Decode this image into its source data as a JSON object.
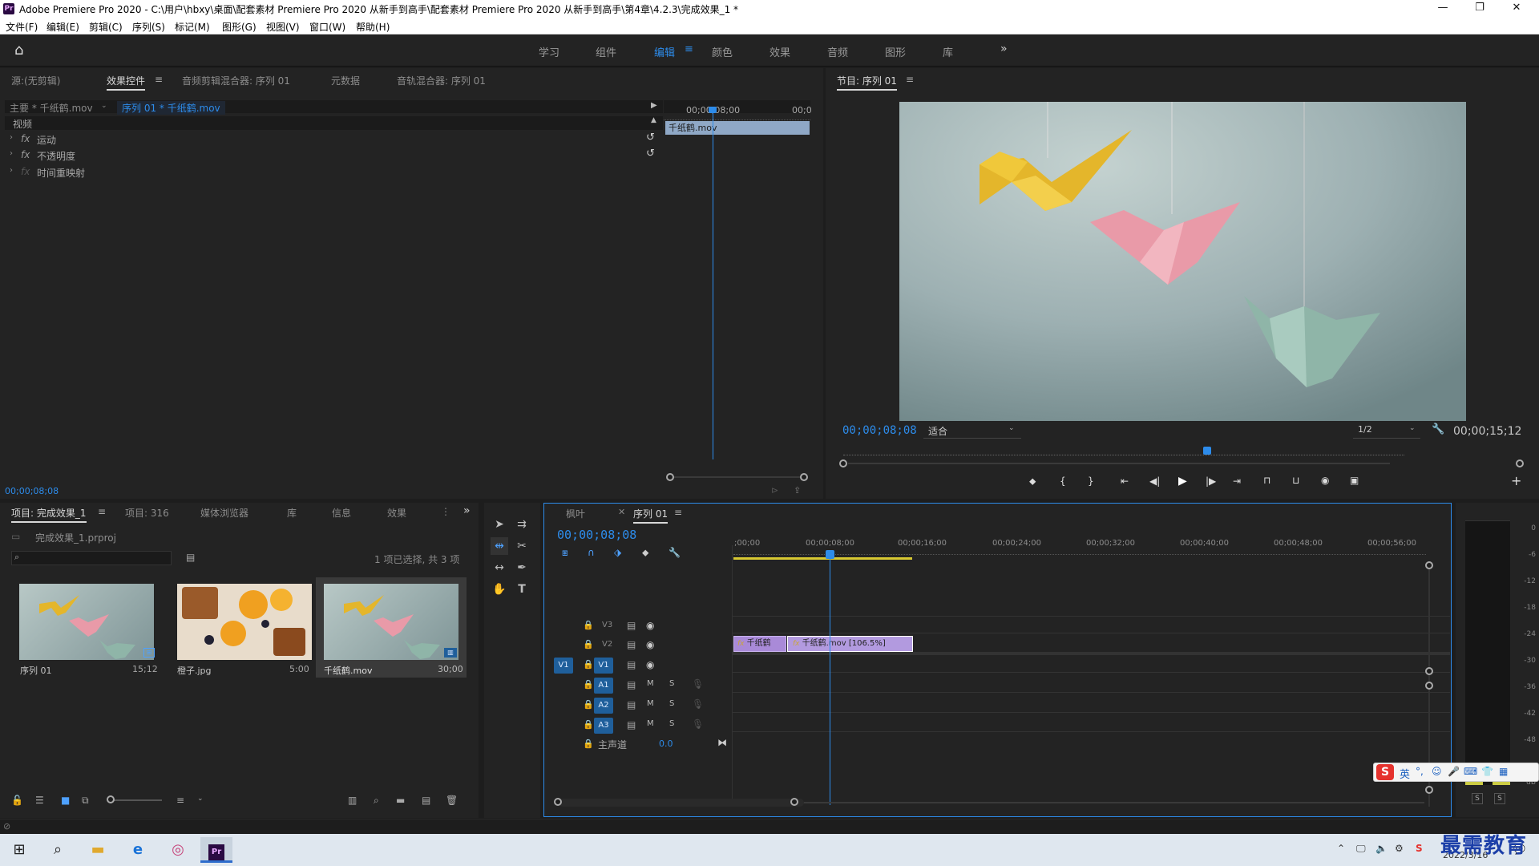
{
  "window": {
    "title": "Adobe Premiere Pro 2020 - C:\\用户\\hbxy\\桌面\\配套素材 Premiere Pro 2020 从新手到高手\\配套素材 Premiere Pro 2020 从新手到高手\\第4章\\4.2.3\\完成效果_1 *",
    "logo": "Pr"
  },
  "menu": [
    "文件(F)",
    "编辑(E)",
    "剪辑(C)",
    "序列(S)",
    "标记(M)",
    "图形(G)",
    "视图(V)",
    "窗口(W)",
    "帮助(H)"
  ],
  "workspaces": [
    "学习",
    "组件",
    "编辑",
    "颜色",
    "效果",
    "音频",
    "图形",
    "库"
  ],
  "workspace_active": "编辑",
  "source_panel": {
    "tabs": [
      "源:(无剪辑)",
      "效果控件",
      "音频剪辑混合器: 序列 01",
      "元数据",
      "音轨混合器: 序列 01"
    ],
    "master_label": "主要 * 千纸鹤.mov",
    "sequence_label": "序列 01 * 千纸鹤.mov",
    "ruler_time": "00;00;08;00",
    "ruler_time2": "00;0",
    "clip_label": "千纸鹤.mov",
    "section": "视频",
    "effects": [
      "运动",
      "不透明度",
      "时间重映射"
    ],
    "fx_label": "fx",
    "timecode": "00;00;08;08"
  },
  "program_monitor": {
    "title": "节目: 序列 01",
    "timecode": "00;00;08;08",
    "fit": "适合",
    "resolution": "1/2",
    "duration": "00;00;15;12"
  },
  "project_panel": {
    "tabs": [
      "项目: 完成效果_1",
      "项目: 316",
      "媒体浏览器",
      "库",
      "信息",
      "效果"
    ],
    "file": "完成效果_1.prproj",
    "selection": "1 项已选择, 共 3 项",
    "items": [
      {
        "name": "序列 01",
        "duration": "15;12"
      },
      {
        "name": "橙子.jpg",
        "duration": "5:00"
      },
      {
        "name": "千纸鹤.mov",
        "duration": "30;00"
      }
    ]
  },
  "timeline": {
    "tabs": [
      "枫叶",
      "序列 01"
    ],
    "timecode": "00;00;08;08",
    "ruler": [
      ";00;00",
      "00;00;08;00",
      "00;00;16;00",
      "00;00;24;00",
      "00;00;32;00",
      "00;00;40;00",
      "00;00;48;00",
      "00;00;56;00"
    ],
    "video_tracks": [
      "V3",
      "V2",
      "V1"
    ],
    "audio_tracks": [
      "A1",
      "A2",
      "A3"
    ],
    "source_patch": "V1",
    "master_label": "主声道",
    "master_value": "0.0",
    "mute": "M",
    "solo": "S",
    "clips": [
      "千纸鹤",
      "千纸鹤.mov [106.5%]"
    ]
  },
  "meter": {
    "labels": [
      "0",
      "-6",
      "-12",
      "-18",
      "-24",
      "-30",
      "-36",
      "-42",
      "-48",
      "dB"
    ],
    "solo_labels": [
      "S",
      "S"
    ]
  },
  "ime": {
    "label": "英"
  },
  "watermark": "最需教育",
  "taskbar": {
    "date": "2022/3/16"
  },
  "colors": {
    "accent": "#2d8ceb",
    "clip": "#a98ad8",
    "bg": "#232323"
  }
}
